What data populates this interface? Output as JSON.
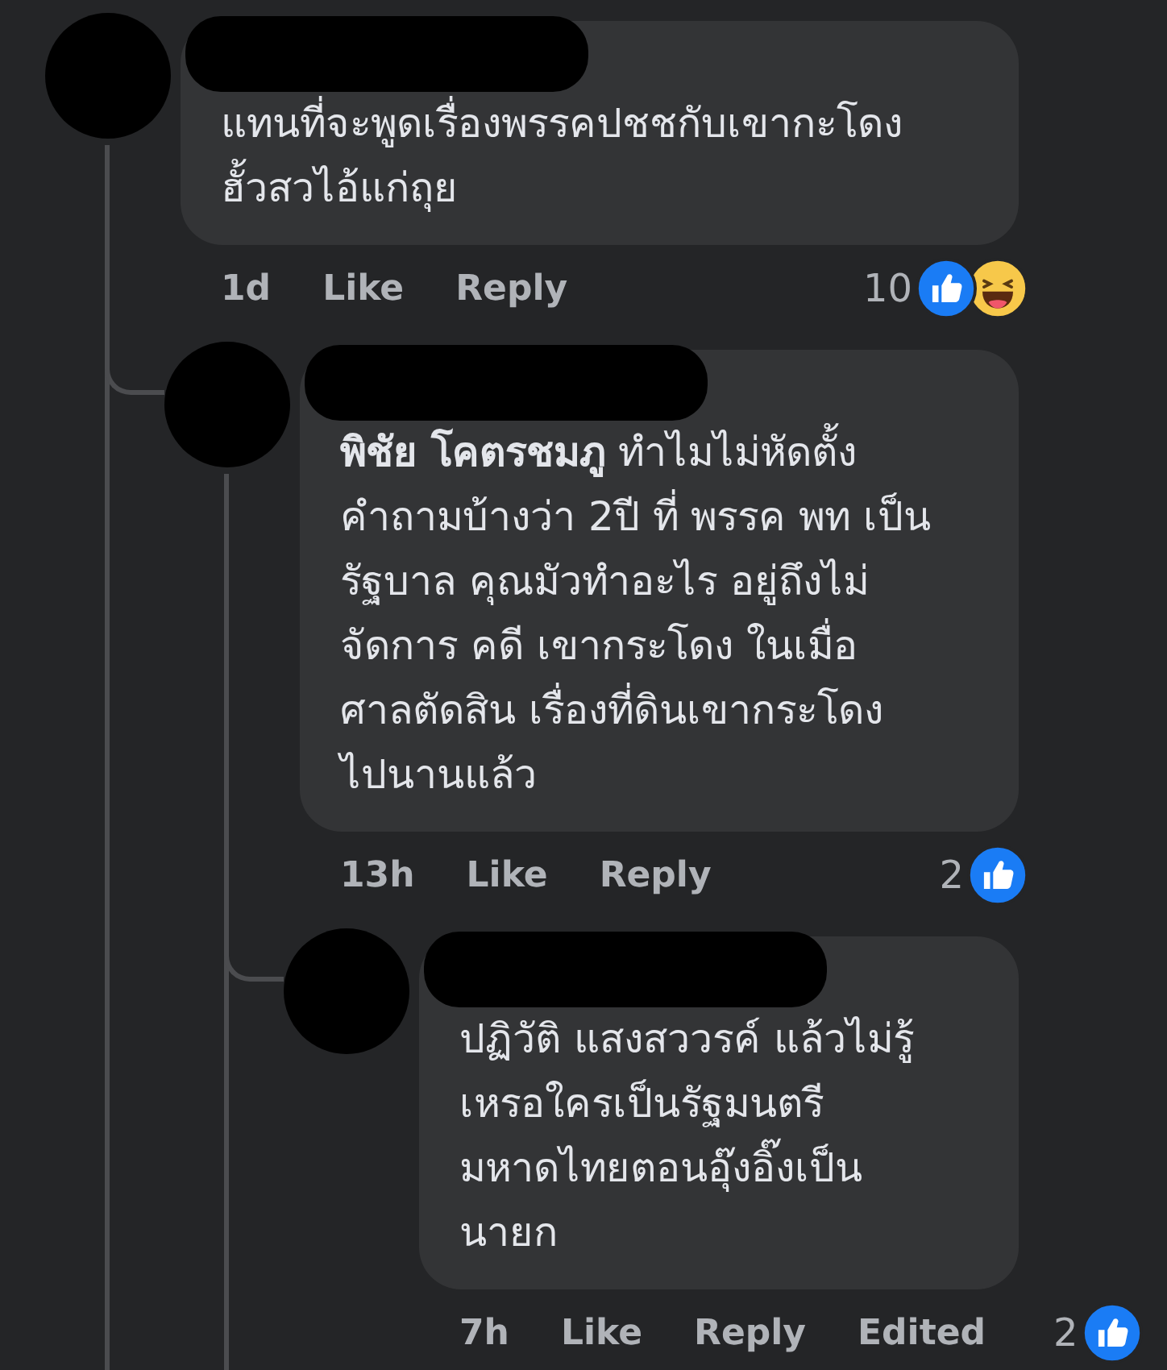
{
  "comments": [
    {
      "text": "แทนที่จะพูดเรื่องพรรคปชชกับเขากะโดงฮั้วสวไอ้แก่ถุย",
      "time": "1d",
      "actions": [
        "Like",
        "Reply"
      ],
      "reaction_count": "10",
      "reactions": [
        {
          "kind": "like"
        },
        {
          "kind": "haha"
        }
      ],
      "children": [
        {
          "text": "**พิชัย โคตรชมภู** ทำไมไม่หัดตั้งคำถามบ้างว่า 2ปี ที่ พรรค พท เป็น รัฐบาล คุณมัวทำอะไร อยู่ถึงไม่จัดการ คดี เขากระโดง ในเมื่อ ศาลตัดสิน เรื่องที่ดินเขากระโดง ไปนานแล้ว",
          "time": "13h",
          "actions": [
            "Like",
            "Reply"
          ],
          "reaction_count": "2",
          "reactions": [
            {
              "kind": "like"
            }
          ],
          "children": [
            {
              "text": "ปฏิวัติ แสงสววรค์ แล้วไม่รู้เหรอใครเป็นรัฐมนตรีมหาดไทยตอนอุ๊งอิ๊งเป็นนายก",
              "time": "7h",
              "actions": [
                "Like",
                "Reply"
              ],
              "edited_label": "Edited",
              "reaction_count": "2",
              "reactions": [
                {
                  "kind": "like"
                }
              ]
            }
          ]
        }
      ]
    }
  ]
}
